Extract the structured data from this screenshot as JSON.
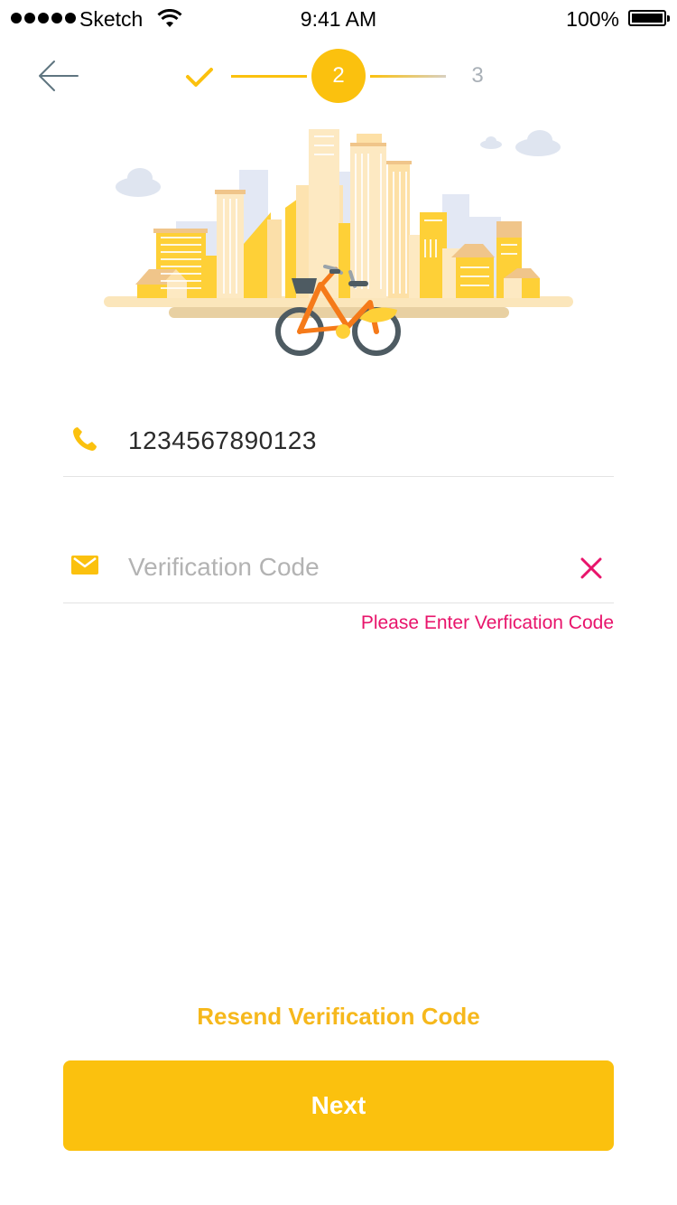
{
  "status_bar": {
    "carrier": "Sketch",
    "time": "9:41 AM",
    "battery": "100%"
  },
  "stepper": {
    "current_step": "2",
    "next_step": "3",
    "active_color": "#fbc10e"
  },
  "phone": {
    "icon": "phone-icon",
    "value": "1234567890123"
  },
  "verification": {
    "icon": "mail-icon",
    "value": "",
    "placeholder": "Verification Code",
    "error": "Please Enter Verfication Code",
    "error_color": "#e8146b"
  },
  "actions": {
    "resend_label": "Resend Verification Code",
    "next_label": "Next"
  }
}
